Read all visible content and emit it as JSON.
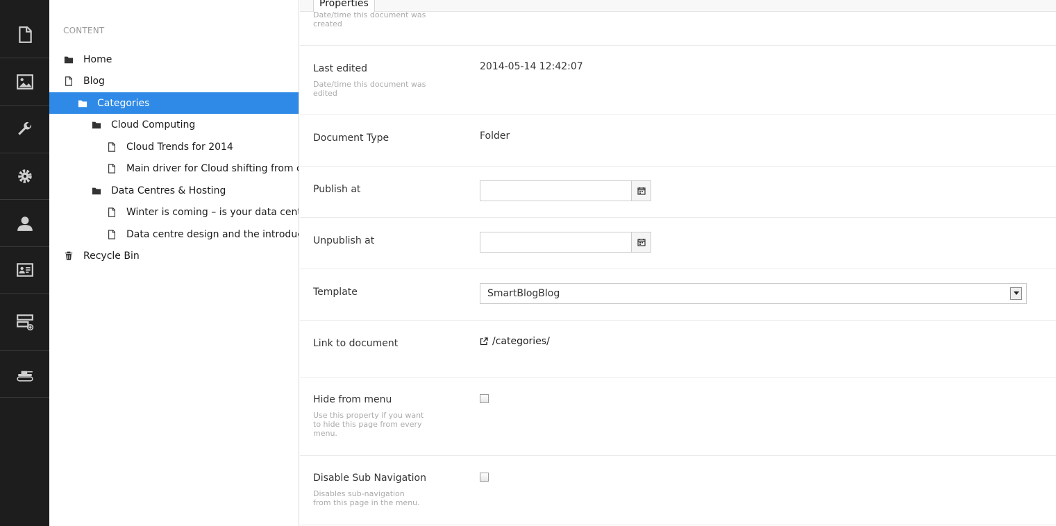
{
  "rail": {
    "items": [
      {
        "name": "content-section",
        "icon": "document-icon"
      },
      {
        "name": "media-section",
        "icon": "image-icon"
      },
      {
        "name": "developer-section",
        "icon": "wrench-icon"
      },
      {
        "name": "settings-section",
        "icon": "gear-icon"
      },
      {
        "name": "users-section",
        "icon": "user-icon"
      },
      {
        "name": "members-section",
        "icon": "id-card-icon"
      },
      {
        "name": "forms-section",
        "icon": "form-add-icon"
      },
      {
        "name": "deploy-section",
        "icon": "tank-icon"
      }
    ]
  },
  "tree": {
    "header": "CONTENT",
    "items": [
      {
        "label": "Home",
        "icon": "folder-icon",
        "level": 0
      },
      {
        "label": "Blog",
        "icon": "document-icon",
        "level": 0
      },
      {
        "label": "Categories",
        "icon": "folder-icon",
        "level": 1,
        "selected": true
      },
      {
        "label": "Cloud Computing",
        "icon": "folder-icon",
        "level": 2
      },
      {
        "label": "Cloud Trends for 2014",
        "icon": "document-icon",
        "level": 3
      },
      {
        "label": "Main driver for Cloud shifting from co",
        "icon": "document-icon",
        "level": 3
      },
      {
        "label": "Data Centres & Hosting",
        "icon": "folder-icon",
        "level": 2
      },
      {
        "label": "Winter is coming – is your data centre",
        "icon": "document-icon",
        "level": 3
      },
      {
        "label": "Data centre design and the introduct",
        "icon": "document-icon",
        "level": 3
      },
      {
        "label": "Recycle Bin",
        "icon": "trash-icon",
        "level": 0
      }
    ]
  },
  "main": {
    "tab_label": "Properties",
    "created": {
      "desc": "Date/time this document was created"
    },
    "last_edited": {
      "label": "Last edited",
      "desc": "Date/time this document was edited",
      "value": "2014-05-14 12:42:07"
    },
    "document_type": {
      "label": "Document Type",
      "value": "Folder"
    },
    "publish_at": {
      "label": "Publish at",
      "value": ""
    },
    "unpublish_at": {
      "label": "Unpublish at",
      "value": ""
    },
    "template": {
      "label": "Template",
      "value": "SmartBlogBlog"
    },
    "link": {
      "label": "Link to document",
      "value": "/categories/"
    },
    "hide_from_menu": {
      "label": "Hide from menu",
      "desc": "Use this property if you want to hide this page from every menu.",
      "checked": false
    },
    "disable_sub_nav": {
      "label": "Disable Sub Navigation",
      "desc": "Disables sub-navigation from this page in the menu.",
      "checked": false
    }
  }
}
